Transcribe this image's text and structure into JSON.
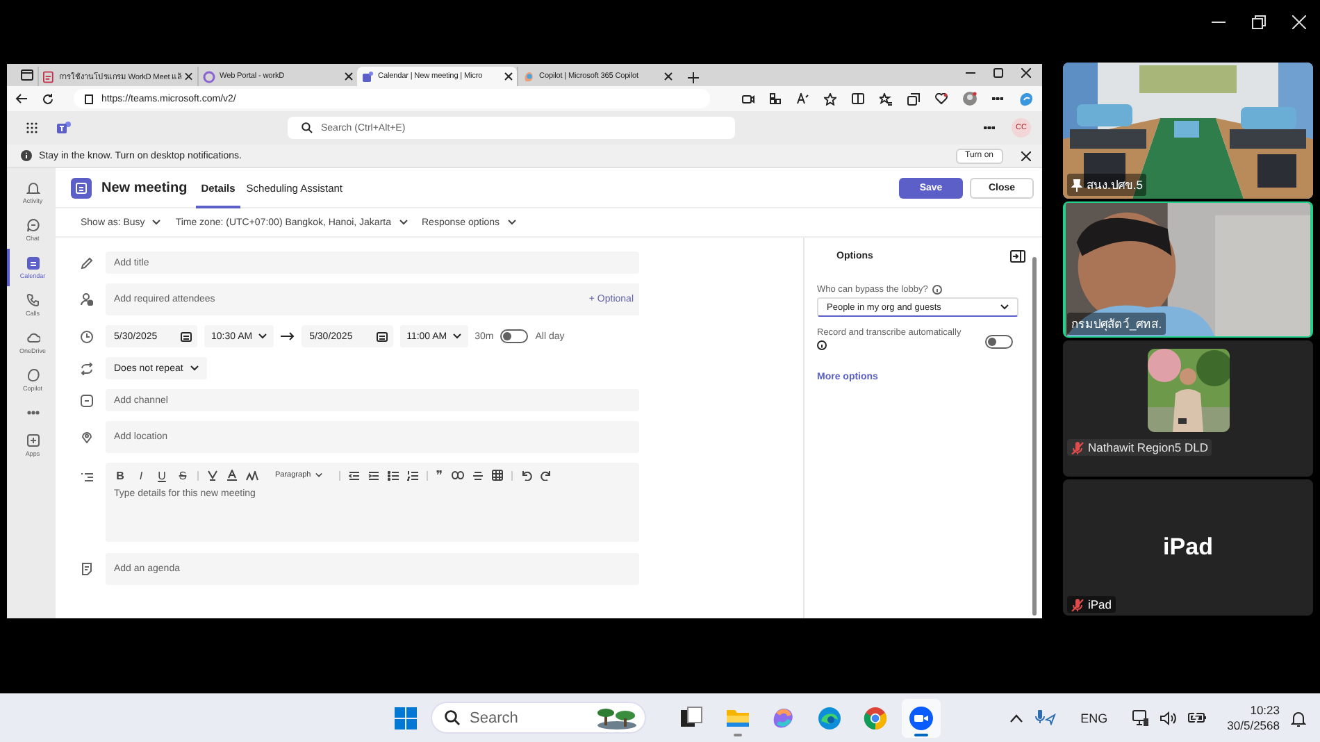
{
  "browser": {
    "tabs": [
      {
        "kind": "pdf",
        "title": "การใช้งานโปรแกรม WorkD Meet แล้",
        "selected": false
      },
      {
        "kind": "portal",
        "title": "Web Portal - workD",
        "selected": false
      },
      {
        "kind": "teams",
        "title": "Calendar | New meeting | Micro",
        "selected": true
      },
      {
        "kind": "copilot",
        "title": "Copilot | Microsoft 365 Copilot",
        "selected": false
      }
    ],
    "url": "https://teams.microsoft.com/v2/"
  },
  "teams_header": {
    "search_placeholder": "Search (Ctrl+Alt+E)",
    "avatar_initials": "CC"
  },
  "notification": {
    "text": "Stay in the know. Turn on desktop notifications.",
    "button": "Turn on"
  },
  "sidebar": {
    "items": [
      {
        "kind": "bell",
        "label": "Activity",
        "selected": false
      },
      {
        "kind": "chat",
        "label": "Chat",
        "selected": false
      },
      {
        "kind": "calendar",
        "label": "Calendar",
        "selected": true
      },
      {
        "kind": "phone",
        "label": "Calls",
        "selected": false
      },
      {
        "kind": "cloud",
        "label": "OneDrive",
        "selected": false
      },
      {
        "kind": "copilot",
        "label": "Copilot",
        "selected": false
      },
      {
        "kind": "more",
        "selected": false
      },
      {
        "kind": "apps",
        "label": "Apps",
        "selected": false
      }
    ]
  },
  "meeting": {
    "title": "New meeting",
    "tabs": [
      {
        "label": "Details",
        "selected": true
      },
      {
        "label": "Scheduling Assistant",
        "selected": false
      }
    ],
    "buttons": [
      {
        "label": "Save",
        "kind": "primary"
      },
      {
        "label": "Close",
        "kind": "secondary"
      }
    ]
  },
  "options_row": [
    "Show as: Busy",
    "Time zone: (UTC+07:00) Bangkok, Hanoi, Jakarta",
    "Response options"
  ],
  "form": {
    "title_placeholder": "Add title",
    "attendees_placeholder": "Add required attendees",
    "optional_link": "+ Optional",
    "start_date": "5/30/2025",
    "start_time": "10:30 AM",
    "end_date": "5/30/2025",
    "end_time": "11:00 AM",
    "duration": "30m",
    "all_day": {
      "label": "All day",
      "on": false
    },
    "repeat": "Does not repeat",
    "channel_placeholder": "Add channel",
    "location_placeholder": "Add location",
    "format_letters": [
      "B",
      "I",
      "U",
      "S"
    ],
    "paragraph": "Paragraph",
    "quote": "❞",
    "details_placeholder": "Type details for this new meeting",
    "agenda_placeholder": "Add an agenda"
  },
  "options_panel": {
    "title": "Options",
    "lobby_label": "Who can bypass the lobby?",
    "lobby_value": "People in my org and guests",
    "record_label": "Record and transcribe automatically",
    "record_on": false,
    "more_link": "More options"
  },
  "participants": [
    {
      "kind": "room",
      "name": "สนง.ปศข.5",
      "pinned": true,
      "muted": false,
      "speaking": false
    },
    {
      "kind": "camera",
      "name": "กรมปศุสัตว์_ศทส.",
      "pinned": false,
      "muted": false,
      "speaking": true
    },
    {
      "kind": "avatar",
      "name": "Nathawit Region5 DLD",
      "pinned": false,
      "muted": true,
      "speaking": false
    },
    {
      "kind": "text",
      "display": "iPad",
      "name": "iPad",
      "pinned": false,
      "muted": true,
      "speaking": false
    }
  ],
  "taskbar": {
    "search_placeholder": "Search",
    "apps": [
      {
        "kind": "taskview",
        "running": false,
        "selected": false
      },
      {
        "kind": "files",
        "running": true,
        "selected": false
      },
      {
        "kind": "copilot",
        "running": false,
        "selected": false
      },
      {
        "kind": "edge",
        "running": false,
        "selected": false
      },
      {
        "kind": "chrome",
        "running": false,
        "selected": false
      },
      {
        "kind": "zoom",
        "running": true,
        "selected": true
      }
    ],
    "language": "ENG",
    "time": "10:23",
    "date": "30/5/2568"
  }
}
